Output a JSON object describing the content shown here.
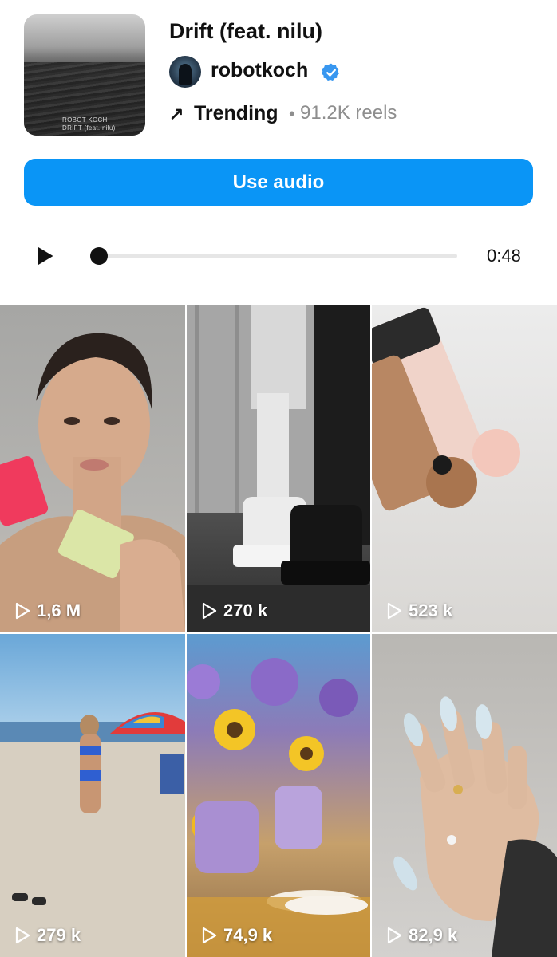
{
  "audio": {
    "cover_artist": "ROBOT KOCH",
    "cover_track": "DRIFT (feat. nilu)",
    "title": "Drift (feat. nilu)",
    "username": "robotkoch",
    "verified": true,
    "trend_arrow": "↗",
    "trend_label": "Trending",
    "separator": "•",
    "reels_count": "91.2K reels",
    "use_button": "Use audio"
  },
  "player": {
    "duration": "0:48",
    "progress": 0
  },
  "reels": [
    {
      "views": "1,6 M",
      "theme": "skincare-selfie"
    },
    {
      "views": "270 k",
      "theme": "boots-fashion"
    },
    {
      "views": "523 k",
      "theme": "concealer-tubes"
    },
    {
      "views": "279 k",
      "theme": "beach"
    },
    {
      "views": "74,9 k",
      "theme": "flower-table"
    },
    {
      "views": "82,9 k",
      "theme": "nail-manicure"
    }
  ],
  "colors": {
    "accent": "#0a95f6",
    "verified": "#3897f0",
    "secondary_text": "#8e8e8e"
  },
  "icons": [
    "trending-arrow-icon",
    "verified-badge-icon",
    "play-icon",
    "reel-play-icon"
  ]
}
